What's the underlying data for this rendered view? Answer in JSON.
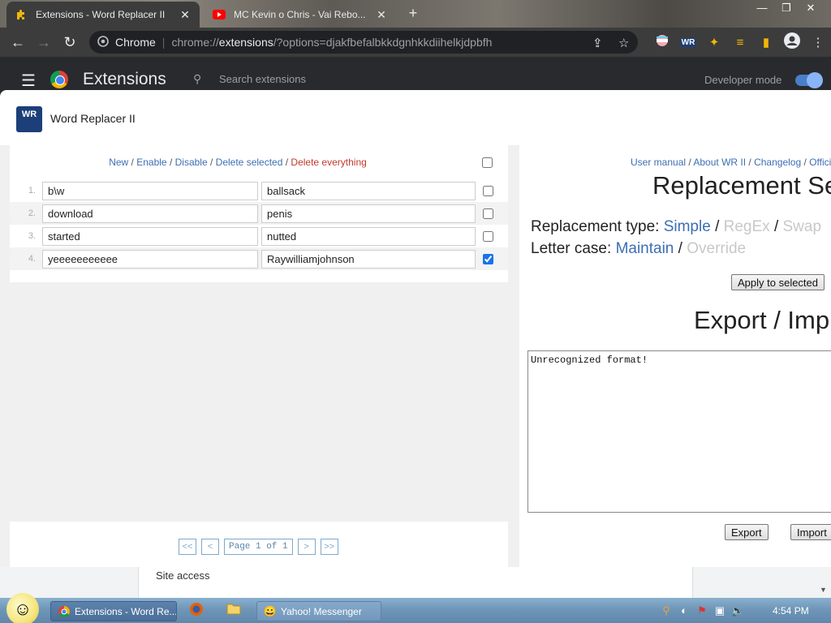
{
  "browser": {
    "tabs": [
      {
        "title": "Extensions - Word Replacer II",
        "active": true
      },
      {
        "title": "MC Kevin o Chris - Vai Rebo...",
        "active": false
      }
    ],
    "new_tab": "+",
    "omnibox": {
      "site_label": "Chrome",
      "url_scheme": "chrome://",
      "url_host": "extensions",
      "url_rest": "/?options=djakfbefalbkkdgnhkkdiihelkjdpbfh"
    }
  },
  "extensions_page": {
    "title": "Extensions",
    "search_placeholder": "Search extensions",
    "developer_mode_label": "Developer mode",
    "developer_mode": true,
    "site_access": "Site access"
  },
  "dialog": {
    "title": "Word Replacer II",
    "logo_text": "WR",
    "actions": {
      "new": "New",
      "enable": "Enable",
      "disable": "Disable",
      "delete_selected": "Delete selected",
      "delete_everything": "Delete everything",
      "separator": " / "
    },
    "rules": [
      {
        "num": "1.",
        "find": "b\\w",
        "replace": "ballsack",
        "checked": false
      },
      {
        "num": "2.",
        "find": "download",
        "replace": "penis",
        "checked": false
      },
      {
        "num": "3.",
        "find": "started",
        "replace": "nutted",
        "checked": false
      },
      {
        "num": "4.",
        "find": "yeeeeeeeeeee",
        "replace": "Raywilliamjohnson",
        "checked": true
      }
    ],
    "pager": {
      "first": "<<",
      "prev": "<",
      "page_text": "Page 1 of 1",
      "next": ">",
      "last": ">>"
    },
    "right": {
      "links": {
        "user_manual": "User manual",
        "about": "About WR II",
        "changelog": "Changelog",
        "official": "Offici"
      },
      "replacement_settings_title": "Replacement Se",
      "replacement_type_label": "Replacement type:",
      "type_simple": "Simple",
      "type_regex": "RegEx",
      "type_swap": "Swap",
      "letter_case_label": "Letter case:",
      "case_maintain": "Maintain",
      "case_override": "Override",
      "apply_button": "Apply to selected",
      "export_import_title": "Export / Imp",
      "export_text": "Unrecognized format!",
      "export_button": "Export",
      "import_button": "Import"
    }
  },
  "taskbar": {
    "tasks": [
      {
        "label": "Extensions - Word Re...",
        "active": true
      },
      {
        "label": "Yahoo! Messenger",
        "active": false
      }
    ],
    "clock": "4:54 PM"
  },
  "colors": {
    "link": "#3c6eb4",
    "danger": "#c0392b",
    "disabled": "#c8c8c8",
    "chrome_dark": "#3c3c3c"
  }
}
